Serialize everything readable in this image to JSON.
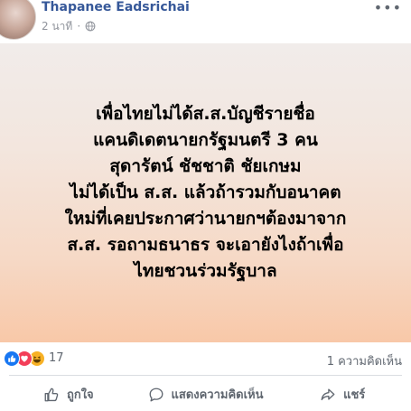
{
  "post": {
    "author_name": "Thapanee Eadsrichai",
    "timestamp": "2 นาที",
    "meta_separator": "·",
    "privacy_icon": "globe-icon",
    "more_icon": "more-horizontal-icon",
    "more_glyph": "•••",
    "card_text": "เพื่อไทยไม่ได้ส.ส.บัญชีรายชื่อ\nแคนดิเดตนายกรัฐมนตรี 3 คน\nสุดารัตน์ ชัชชาติ ชัยเกษม\nไม่ได้เป็น ส.ส. แล้วถ้ารวมกับอนาคต\nใหม่ที่เคยประกาศว่านายกฯต้องมาจาก\nส.ส. รอถามธนาธร จะเอายังไงถ้าเพื่อ\nไทยชวนร่วมรัฐบาล",
    "card_gradient": [
      "#f1ecea",
      "#f8c8a8"
    ]
  },
  "reactions": {
    "icons": [
      "like-reaction-icon",
      "love-reaction-icon",
      "haha-reaction-icon"
    ],
    "count": "17",
    "comments": "1 ความคิดเห็น"
  },
  "actions": {
    "like": "ถูกใจ",
    "comment": "แสดงความคิดเห็น",
    "share": "แชร์"
  },
  "colors": {
    "author": "#365899",
    "meta": "#90949c",
    "action_text": "#606770",
    "like": "#1877f2",
    "love": "#f33e58",
    "haha": "#f7b125"
  }
}
